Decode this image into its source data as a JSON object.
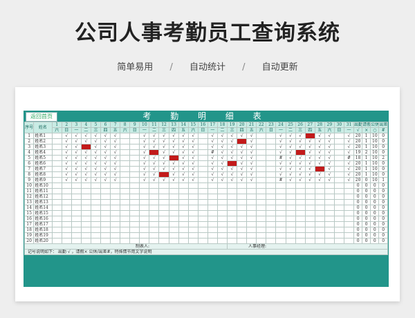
{
  "page": {
    "title": "公司人事考勤员工查询系统",
    "features": [
      "简单易用",
      "/",
      "自动统计",
      "/",
      "自动更新"
    ]
  },
  "sheet": {
    "back_button": "返回首页",
    "title": "考 勤 明 细 表",
    "header_seq": "序号",
    "header_name": "姓名",
    "days": [
      "1",
      "2",
      "3",
      "4",
      "5",
      "6",
      "7",
      "8",
      "9",
      "10",
      "11",
      "12",
      "13",
      "14",
      "15",
      "16",
      "17",
      "18",
      "19",
      "20",
      "21",
      "22",
      "23",
      "24",
      "25",
      "26",
      "27",
      "28",
      "29",
      "30",
      "31"
    ],
    "weekdays": [
      "六",
      "日",
      "一",
      "二",
      "三",
      "四",
      "五",
      "六",
      "日",
      "一",
      "二",
      "三",
      "四",
      "五",
      "六",
      "日",
      "一",
      "二",
      "三",
      "四",
      "五",
      "六",
      "日",
      "一",
      "二",
      "三",
      "四",
      "五",
      "六",
      "日",
      "一"
    ],
    "summary_headers": [
      "出勤",
      "请假",
      "公休",
      "出差"
    ],
    "summary_symbols": [
      "√",
      "×",
      "○",
      "#"
    ],
    "rows": [
      {
        "seq": "1",
        "name": "姓名1",
        "marks": [
          "",
          "√",
          "√",
          "√",
          "√",
          "√",
          "√",
          "",
          "",
          "√",
          "√",
          "√",
          "√",
          "√",
          "√",
          "",
          "√",
          "√",
          "√",
          "√",
          "√",
          "",
          "",
          "√",
          "√",
          "√",
          "L",
          "√",
          "√",
          "",
          "√"
        ],
        "totals": [
          "20",
          "1",
          "10",
          "0"
        ]
      },
      {
        "seq": "2",
        "name": "姓名2",
        "marks": [
          "",
          "√",
          "√",
          "√",
          "√",
          "√",
          "√",
          "",
          "",
          "√",
          "√",
          "√",
          "√",
          "√",
          "√",
          "",
          "√",
          "√",
          "√",
          "L",
          "√",
          "",
          "",
          "√",
          "√",
          "√",
          "√",
          "√",
          "√",
          "",
          "√"
        ],
        "totals": [
          "20",
          "1",
          "10",
          "0"
        ]
      },
      {
        "seq": "3",
        "name": "姓名3",
        "marks": [
          "",
          "√",
          "√",
          "L",
          "√",
          "√",
          "√",
          "",
          "",
          "√",
          "√",
          "√",
          "√",
          "√",
          "√",
          "",
          "√",
          "√",
          "√",
          "√",
          "√",
          "",
          "",
          "√",
          "√",
          "√",
          "√",
          "√",
          "√",
          "",
          "√"
        ],
        "totals": [
          "20",
          "1",
          "10",
          "0"
        ]
      },
      {
        "seq": "4",
        "name": "姓名4",
        "marks": [
          "",
          "√",
          "√",
          "√",
          "√",
          "√",
          "√",
          "",
          "",
          "√",
          "L",
          "√",
          "√",
          "√",
          "√",
          "",
          "#",
          "√",
          "√",
          "√",
          "√",
          "",
          "",
          "√",
          "√",
          "L",
          "√",
          "√",
          "√",
          "",
          "√"
        ],
        "totals": [
          "19",
          "2",
          "10",
          "0"
        ]
      },
      {
        "seq": "5",
        "name": "姓名5",
        "marks": [
          "",
          "√",
          "√",
          "√",
          "√",
          "√",
          "√",
          "",
          "",
          "√",
          "√",
          "√",
          "L",
          "√",
          "√",
          "",
          "√",
          "√",
          "√",
          "√",
          "√",
          "",
          "",
          "#",
          "√",
          "√",
          "√",
          "√",
          "√",
          "",
          "#"
        ],
        "totals": [
          "18",
          "1",
          "10",
          "2"
        ]
      },
      {
        "seq": "6",
        "name": "姓名6",
        "marks": [
          "",
          "√",
          "√",
          "√",
          "√",
          "√",
          "√",
          "",
          "",
          "√",
          "√",
          "√",
          "√",
          "√",
          "√",
          "",
          "√",
          "√",
          "L",
          "√",
          "√",
          "",
          "",
          "√",
          "√",
          "√",
          "√",
          "√",
          "√",
          "",
          "√"
        ],
        "totals": [
          "20",
          "1",
          "10",
          "0"
        ]
      },
      {
        "seq": "7",
        "name": "姓名7",
        "marks": [
          "",
          "√",
          "√",
          "√",
          "√",
          "√",
          "√",
          "",
          "",
          "√",
          "√",
          "√",
          "√",
          "√",
          "√",
          "",
          "√",
          "√",
          "√",
          "√",
          "√",
          "",
          "",
          "√",
          "√",
          "√",
          "√",
          "L",
          "√",
          "",
          "√"
        ],
        "totals": [
          "20",
          "1",
          "10",
          "0"
        ]
      },
      {
        "seq": "8",
        "name": "姓名8",
        "marks": [
          "",
          "√",
          "√",
          "√",
          "√",
          "√",
          "√",
          "",
          "",
          "√",
          "√",
          "L",
          "√",
          "√",
          "√",
          "",
          "√",
          "√",
          "√",
          "√",
          "√",
          "",
          "",
          "√",
          "√",
          "√",
          "√",
          "√",
          "√",
          "",
          "√"
        ],
        "totals": [
          "20",
          "1",
          "10",
          "0"
        ]
      },
      {
        "seq": "9",
        "name": "姓名9",
        "marks": [
          "",
          "√",
          "√",
          "√",
          "√",
          "√",
          "√",
          "",
          "",
          "√",
          "√",
          "√",
          "√",
          "√",
          "√",
          "",
          "√",
          "√",
          "√",
          "√",
          "√",
          "",
          "",
          "#",
          "√",
          "√",
          "√",
          "√",
          "√",
          "",
          "√"
        ],
        "totals": [
          "20",
          "0",
          "10",
          "1"
        ]
      },
      {
        "seq": "10",
        "name": "姓名10",
        "marks": [],
        "totals": [
          "0",
          "0",
          "0",
          "0"
        ]
      },
      {
        "seq": "11",
        "name": "姓名11",
        "marks": [],
        "totals": [
          "0",
          "0",
          "0",
          "0"
        ]
      },
      {
        "seq": "12",
        "name": "姓名12",
        "marks": [],
        "totals": [
          "0",
          "0",
          "0",
          "0"
        ]
      },
      {
        "seq": "13",
        "name": "姓名13",
        "marks": [],
        "totals": [
          "0",
          "0",
          "0",
          "0"
        ]
      },
      {
        "seq": "14",
        "name": "姓名14",
        "marks": [],
        "totals": [
          "0",
          "0",
          "0",
          "0"
        ]
      },
      {
        "seq": "15",
        "name": "姓名15",
        "marks": [],
        "totals": [
          "0",
          "0",
          "0",
          "0"
        ]
      },
      {
        "seq": "16",
        "name": "姓名16",
        "marks": [],
        "totals": [
          "0",
          "0",
          "0",
          "0"
        ]
      },
      {
        "seq": "17",
        "name": "姓名17",
        "marks": [],
        "totals": [
          "0",
          "0",
          "0",
          "0"
        ]
      },
      {
        "seq": "18",
        "name": "姓名18",
        "marks": [],
        "totals": [
          "0",
          "0",
          "0",
          "0"
        ]
      },
      {
        "seq": "19",
        "name": "姓名19",
        "marks": [],
        "totals": [
          "0",
          "0",
          "0",
          "0"
        ]
      },
      {
        "seq": "20",
        "name": "姓名20",
        "marks": [],
        "totals": [
          "0",
          "0",
          "0",
          "0"
        ]
      }
    ],
    "footer": {
      "maker": "制表人:",
      "hr_manager": "人事经理:",
      "legend": "记号说明如下：     出勤 √ ，请假× 公休/出差#，特殊情节用文字说明"
    }
  }
}
